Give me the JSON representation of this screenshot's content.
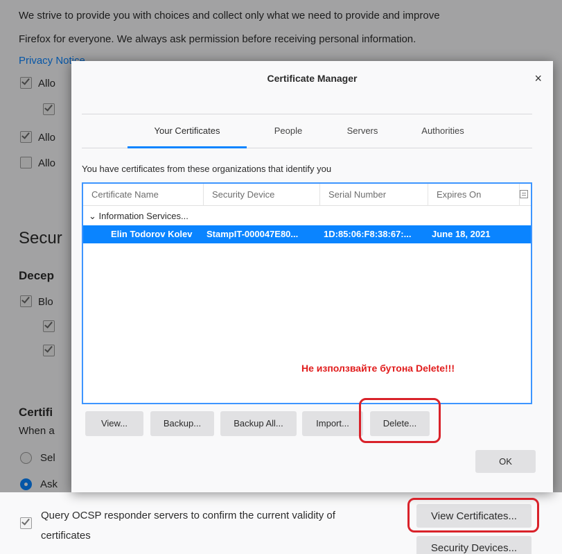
{
  "background": {
    "intro_line1": "We strive to provide you with choices and collect only what we need to provide and improve",
    "intro_line2": "Firefox for everyone. We always ask permission before receiving personal information.",
    "privacy_link": "Privacy Notice",
    "allow1": "Allo",
    "allow2": "Allo",
    "allow3": "Allo",
    "security_heading": "Secur",
    "deceptive_heading": "Decep",
    "block_label": "Blo",
    "certificates_heading": "Certifi",
    "when_label": "When a",
    "select_label": "Sel",
    "ask_label": "Ask",
    "ocsp_line1": "Query OCSP responder servers to confirm the current validity of",
    "ocsp_line2": "certificates",
    "view_certificates_button": "View Certificates...",
    "security_devices_button": "Security Devices..."
  },
  "dialog": {
    "title": "Certificate Manager",
    "close_glyph": "×",
    "tabs": [
      "Your Certificates",
      "People",
      "Servers",
      "Authorities"
    ],
    "intro": "You have certificates from these organizations that identify you",
    "columns": [
      "Certificate Name",
      "Security Device",
      "Serial Number",
      "Expires On"
    ],
    "group": "⌄ Information Services...",
    "selected_row": {
      "name": "Elin Todorov Kolev",
      "device": "StampIT-000047E80...",
      "serial": "1D:85:06:F8:38:67:...",
      "expires": "June 18, 2021"
    },
    "warning": "Не използвайте бутона Delete!!!",
    "buttons": {
      "view": "View...",
      "backup": "Backup...",
      "backup_all": "Backup All...",
      "import": "Import...",
      "delete": "Delete...",
      "ok": "OK"
    }
  },
  "colors": {
    "accent": "#0a84ff",
    "highlight": "#d9222a"
  }
}
